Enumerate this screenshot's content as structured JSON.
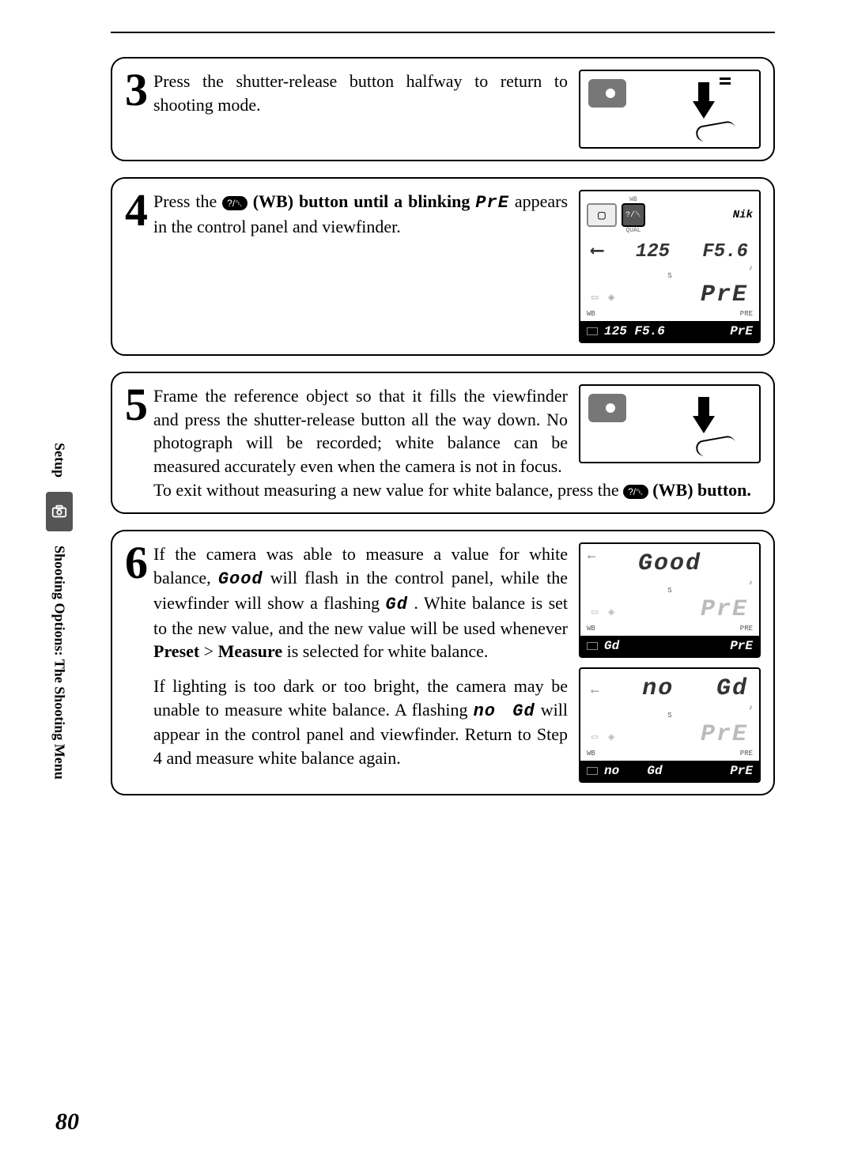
{
  "page_number": "80",
  "sidebar": {
    "label_top": "Setup",
    "label_bottom": "Shooting Options: The Shooting Menu"
  },
  "wb_chip_text": "?/␡",
  "steps": {
    "s3": {
      "num": "3",
      "text": "Press the shutter-release button halfway to return to shooting mode."
    },
    "s4": {
      "num": "4",
      "text_a": "Press the ",
      "text_b": " (WB) button until a blinking ",
      "pre_inline": "PrE",
      "text_c": " appears in the control panel and viewfinder.",
      "lcd": {
        "wb_small": "WB",
        "qual_small": "QUAL",
        "brand": "Nik",
        "shutter": "125",
        "aperture": "F5.6",
        "s_small": "S",
        "pre_big": "PrE",
        "wb_small2": "WB",
        "pre_small": "PRE",
        "vf_left": "125  F5.6",
        "vf_right": "PrE"
      }
    },
    "s5": {
      "num": "5",
      "p1": "Frame the reference object so that it fills the viewfinder and press the shutter-release button all the way down.  No photograph will be recorded; white balance can be measured accurately even when the camera is not in focus.",
      "p2_a": "To exit without measuring a new value for white balance, press the ",
      "p2_b": " (WB) button."
    },
    "s6": {
      "num": "6",
      "p1_a": "If the camera was able to measure a value for white balance, ",
      "good_inline": "Good",
      "p1_b": " will flash in the control panel, while the viewfinder will show a flashing ",
      "gd_inline": "Gd",
      "p1_c": ".  White balance is set to the new value, and the new value will be used whenever ",
      "preset_bold": "Preset",
      "gt": " > ",
      "measure_bold": "Measure",
      "p1_d": " is selected for white balance.",
      "p2_a": "If lighting is too dark or too bright, the camera may be unable to measure white balance.  A flashing ",
      "no_inline": "no",
      "gd_inline2": "Gd",
      "p2_b": " will appear in the control panel and viewfinder.  Return to Step 4 and measure white balance again.",
      "lcd_good": {
        "top_big": "Good",
        "s_small": "S",
        "pre_dim": "PrE",
        "wb_small": "WB",
        "pre_small": "PRE",
        "vf_left": "Gd",
        "vf_right": "PrE"
      },
      "lcd_nogd": {
        "top_left": "no",
        "top_right": "Gd",
        "s_small": "S",
        "pre_dim": "PrE",
        "wb_small": "WB",
        "pre_small": "PRE",
        "vf_l1": "no",
        "vf_l2": "Gd",
        "vf_right": "PrE"
      }
    }
  }
}
